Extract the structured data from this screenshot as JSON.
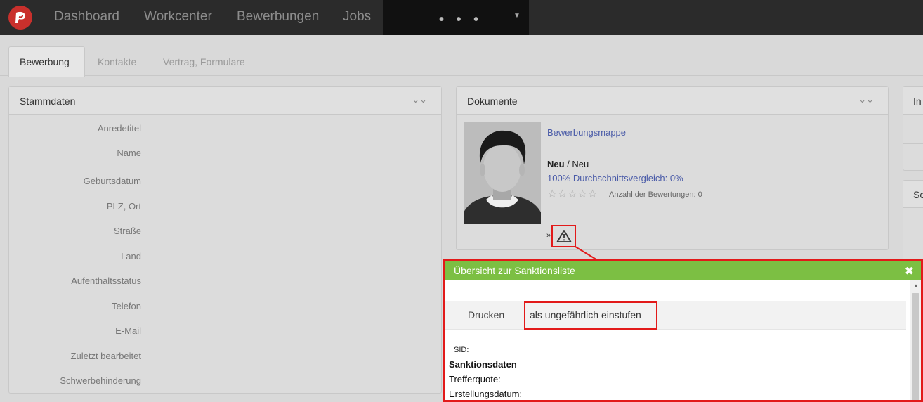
{
  "nav": {
    "items": [
      "Dashboard",
      "Workcenter",
      "Bewerbungen",
      "Jobs"
    ],
    "more": "• • •"
  },
  "tabs": [
    "Bewerbung",
    "Kontakte",
    "Vertrag, Formulare"
  ],
  "stammdaten": {
    "title": "Stammdaten",
    "labels": [
      "Anredetitel",
      "Name",
      "Geburtsdatum",
      "PLZ, Ort",
      "Straße",
      "Land",
      "Aufenthaltsstatus",
      "Telefon",
      "E-Mail",
      "Zuletzt bearbeitet",
      "Schwerbehinderung"
    ]
  },
  "dokumente": {
    "title": "Dokumente",
    "link": "Bewerbungsmappe",
    "status_bold": "Neu",
    "status_rest": " / Neu",
    "compare": "100% Durchschnittsvergleich: 0%",
    "stars": "☆☆☆☆☆",
    "rating_count": "Anzahl der Bewertungen: 0",
    "raquo": "»"
  },
  "right_panels": {
    "top": "In",
    "bottom": "Sc"
  },
  "modal": {
    "title": "Übersicht zur Sanktionsliste",
    "close": "✖",
    "print": "Drucken",
    "mark_safe": "als ungefährlich einstufen",
    "sid": "SID:",
    "section_title": "Sanktionsdaten",
    "trefferquote": "Trefferquote:",
    "erstellungsdatum": "Erstellungsdatum:"
  },
  "colors": {
    "topbar": "#2b2b2b",
    "modal_header": "#7cbf43",
    "highlight": "#e21a1a",
    "link": "#4a5ba8"
  }
}
